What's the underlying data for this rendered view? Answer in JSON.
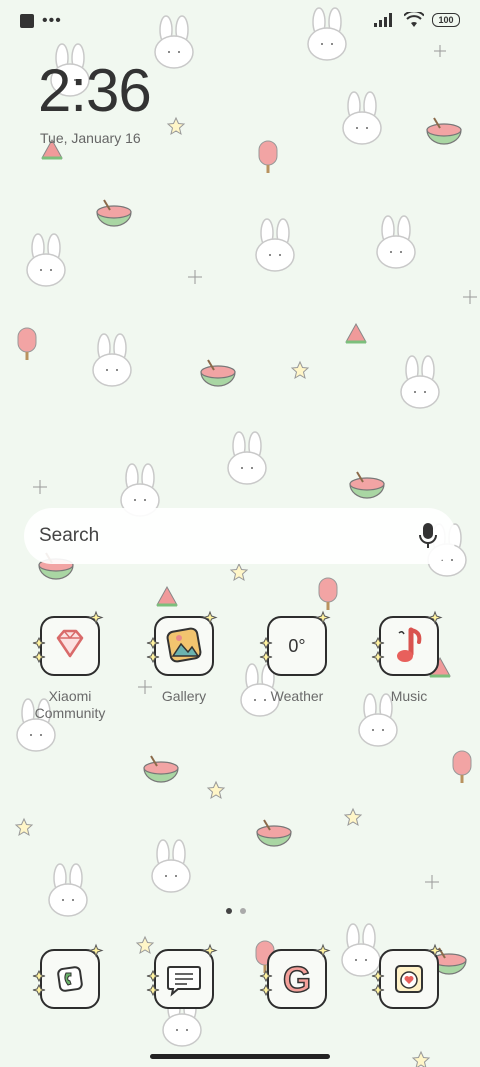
{
  "status_bar": {
    "battery": "100",
    "icons": [
      "notification-square-icon",
      "more-dots-icon",
      "signal-icon",
      "wifi-icon",
      "battery-icon"
    ]
  },
  "lock": {
    "time": "2:36",
    "date": "Tue, January 16"
  },
  "search": {
    "placeholder": "Search",
    "icon": "microphone-icon"
  },
  "apps": [
    {
      "label": "Xiaomi\nCommunity",
      "icon": "diamond-icon"
    },
    {
      "label": "Gallery",
      "icon": "picture-icon"
    },
    {
      "label": "Weather",
      "icon": "weather-icon",
      "temp": "0°"
    },
    {
      "label": "Music",
      "icon": "music-note-icon"
    }
  ],
  "dock": [
    {
      "icon": "phone-icon"
    },
    {
      "icon": "messages-icon"
    },
    {
      "icon": "google-icon",
      "letter": "G"
    },
    {
      "icon": "camera-heart-icon"
    }
  ],
  "pager": {
    "pages": 2,
    "current": 1
  },
  "colors": {
    "background": "#f1f8f0",
    "accent_pink": "#e98a8a",
    "accent_green": "#9fcfa0",
    "outline": "#2d2d2d"
  }
}
